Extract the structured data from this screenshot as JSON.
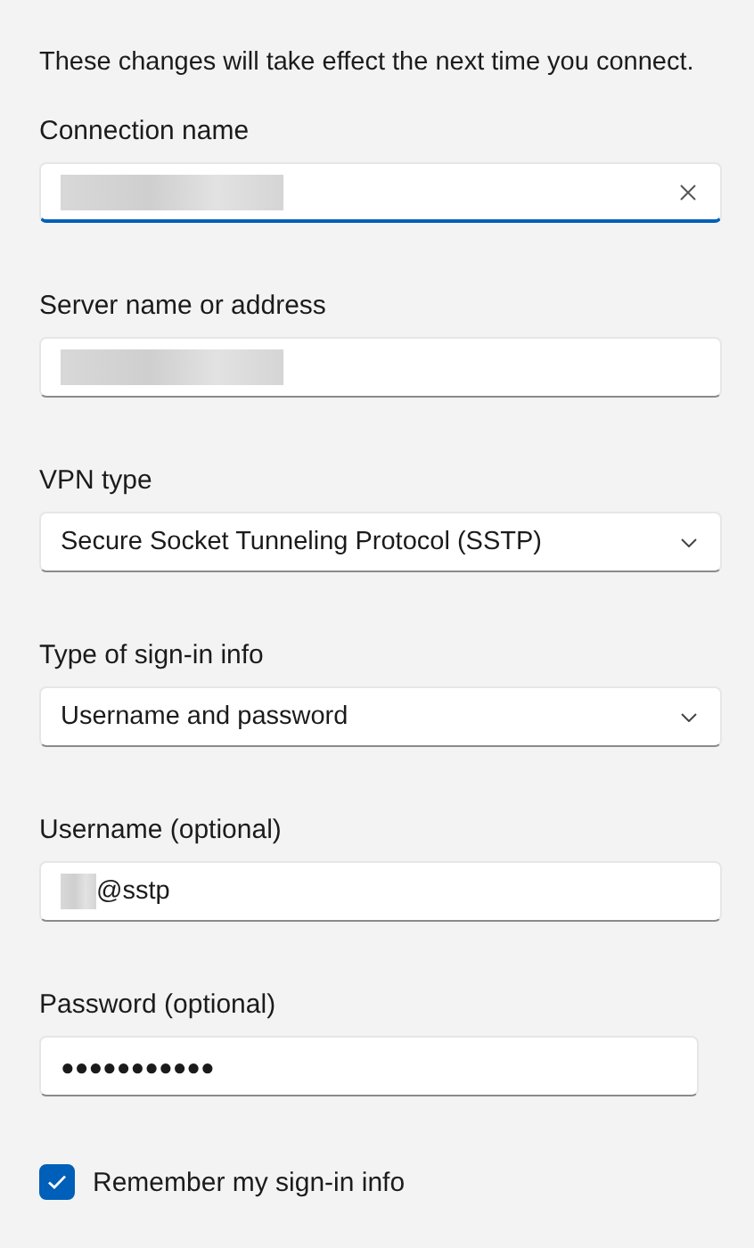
{
  "notice": "These changes will take effect the next time you connect.",
  "fields": [
    {
      "kind": "text",
      "label": "Connection name",
      "redacted": true,
      "focused": true,
      "clearable": true
    },
    {
      "kind": "text",
      "label": "Server name or address",
      "redacted": true,
      "focused": false,
      "clearable": false
    },
    {
      "kind": "dropdown",
      "label": "VPN type",
      "value": "Secure Socket Tunneling Protocol (SSTP)"
    },
    {
      "kind": "dropdown",
      "label": "Type of sign-in info",
      "value": "Username and password"
    },
    {
      "kind": "text",
      "label": "Username (optional)",
      "redacted": true,
      "value": "@sstp",
      "focused": false,
      "clearable": false
    },
    {
      "kind": "password",
      "label": "Password (optional)",
      "value": "●●●●●●●●●●●",
      "focused": false
    }
  ],
  "remember": {
    "label": "Remember my sign-in info",
    "checked": true
  }
}
